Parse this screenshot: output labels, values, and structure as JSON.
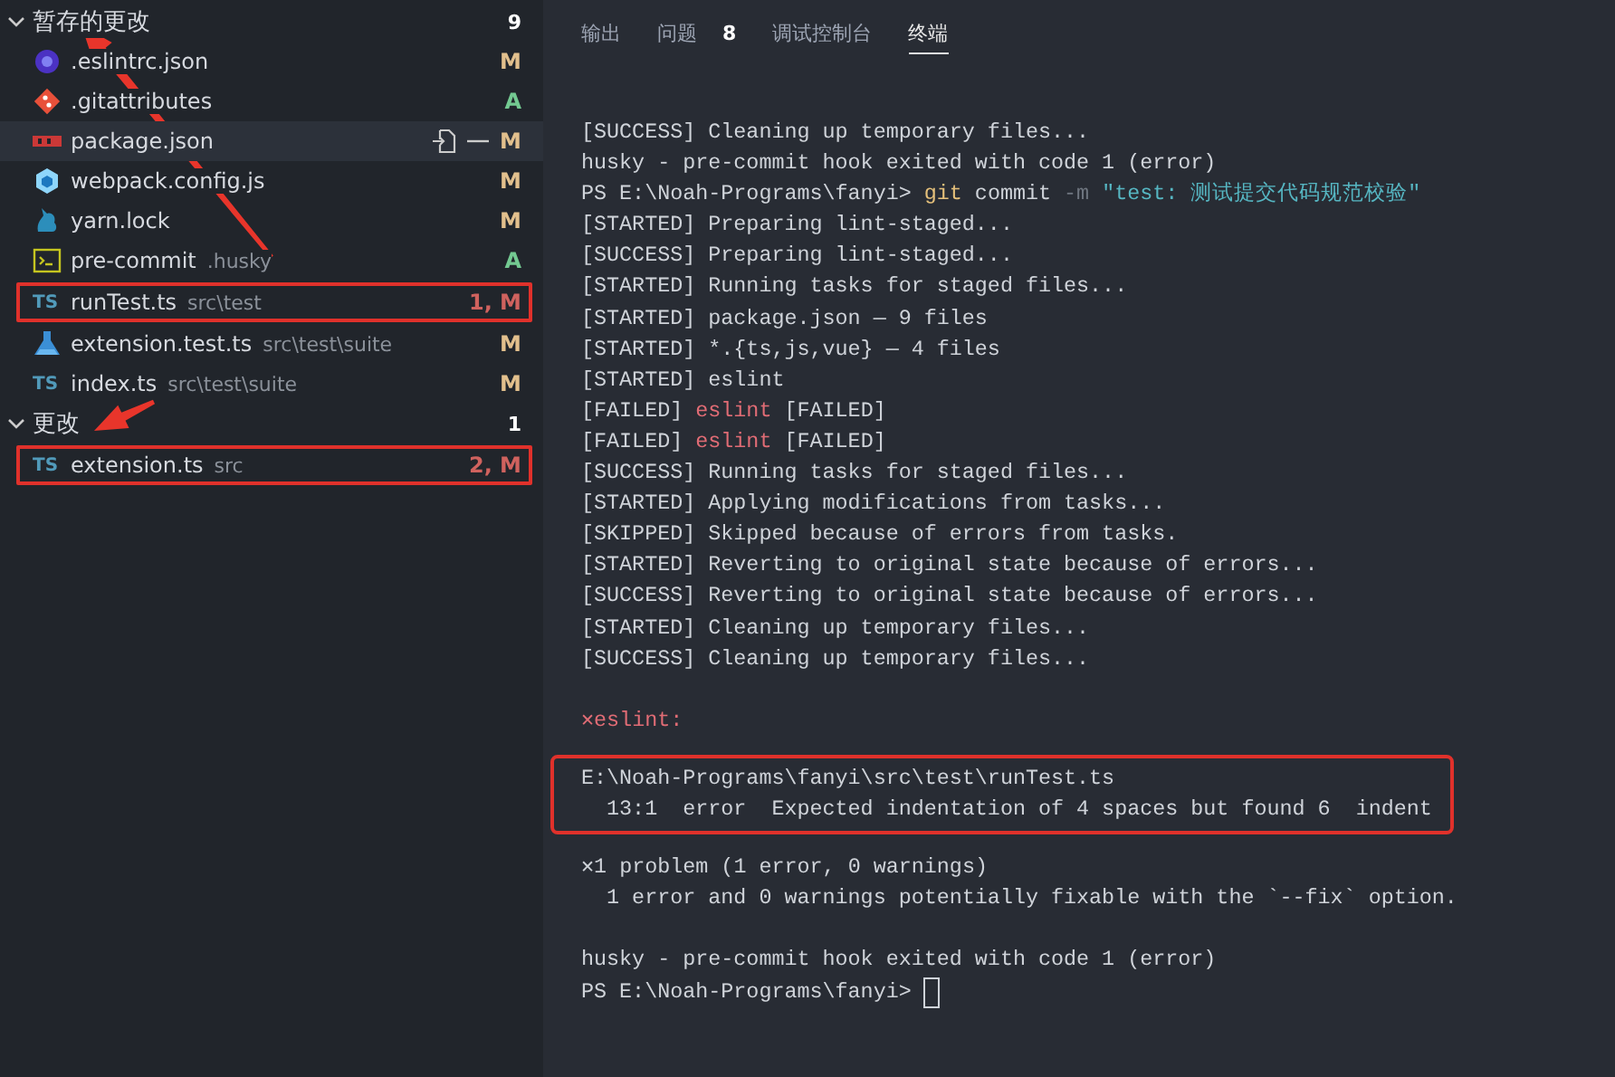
{
  "sidebar": {
    "groups": [
      {
        "title": "暂存的更改",
        "count": "9",
        "expanded": true,
        "items": [
          {
            "kind": "eslint",
            "name": ".eslintrc.json",
            "status": "M",
            "color": "#e2c08d",
            "selected": false,
            "highlighted": false
          },
          {
            "kind": "git",
            "name": ".gitattributes",
            "status": "A",
            "color": "#73c991",
            "selected": false,
            "highlighted": false
          },
          {
            "kind": "npm",
            "name": "package.json",
            "status": "M",
            "color": "#e2c08d",
            "selected": true,
            "highlighted": false
          },
          {
            "kind": "webpack",
            "name": "webpack.config.js",
            "status": "M",
            "color": "#e2c08d",
            "selected": false,
            "highlighted": false
          },
          {
            "kind": "yarn",
            "name": "yarn.lock",
            "status": "M",
            "color": "#e2c08d",
            "selected": false,
            "highlighted": false
          },
          {
            "kind": "shell",
            "name": "pre-commit",
            "description": ".husky",
            "status": "A",
            "color": "#73c991",
            "selected": false,
            "highlighted": false
          },
          {
            "kind": "ts",
            "icon_label": "TS",
            "name": "runTest.ts",
            "description": "src\\test",
            "status": "1, M",
            "color": "#d0625e",
            "selected": false,
            "highlighted": true
          },
          {
            "kind": "test",
            "name": "extension.test.ts",
            "description": "src\\test\\suite",
            "status": "M",
            "color": "#e2c08d",
            "selected": false,
            "highlighted": false
          },
          {
            "kind": "ts",
            "icon_label": "TS",
            "name": "index.ts",
            "description": "src\\test\\suite",
            "status": "M",
            "color": "#e2c08d",
            "selected": false,
            "highlighted": false
          }
        ]
      },
      {
        "title": "更改",
        "count": "1",
        "expanded": true,
        "items": [
          {
            "kind": "ts",
            "icon_label": "TS",
            "name": "extension.ts",
            "description": "src",
            "status": "2, M",
            "color": "#d0625e",
            "selected": false,
            "highlighted": true
          }
        ]
      }
    ]
  },
  "panel": {
    "tabs": [
      {
        "label": "输出",
        "selected": false
      },
      {
        "label": "问题",
        "badge": "8",
        "selected": false
      },
      {
        "label": "调试控制台",
        "selected": false
      },
      {
        "label": "终端",
        "selected": true
      }
    ],
    "terminal": {
      "sections": [
        {
          "lines": [
            [
              {
                "text": "[SUCCESS] Cleaning up temporary files...",
                "kind": "plain"
              }
            ],
            [
              {
                "text": "husky - pre-commit hook exited with code 1 (error)",
                "kind": "plain"
              }
            ],
            [
              {
                "text": "PS E:\\Noah-Programs\\fanyi> ",
                "kind": "plain"
              },
              {
                "text": "git",
                "kind": "command"
              },
              {
                "text": " commit ",
                "kind": "plain"
              },
              {
                "text": "-m",
                "kind": "flag"
              },
              {
                "text": " \"test: 测试提交代码规范校验\"",
                "kind": "string"
              }
            ],
            [
              {
                "text": "[STARTED] Preparing lint-staged...",
                "kind": "plain"
              }
            ],
            [
              {
                "text": "[SUCCESS] Preparing lint-staged...",
                "kind": "plain"
              }
            ],
            [
              {
                "text": "[STARTED] Running tasks for staged files...",
                "kind": "plain"
              }
            ],
            [
              {
                "text": "[STARTED] package.json — 9 files",
                "kind": "plain"
              }
            ],
            [
              {
                "text": "[STARTED] *.{ts,js,vue} — 4 files",
                "kind": "plain"
              }
            ],
            [
              {
                "text": "[STARTED] eslint",
                "kind": "plain"
              }
            ],
            [
              {
                "text": "[FAILED] ",
                "kind": "plain"
              },
              {
                "text": "eslint",
                "kind": "error"
              },
              {
                "text": " [FAILED]",
                "kind": "plain"
              }
            ],
            [
              {
                "text": "[FAILED] ",
                "kind": "plain"
              },
              {
                "text": "eslint",
                "kind": "error"
              },
              {
                "text": " [FAILED]",
                "kind": "plain"
              }
            ],
            [
              {
                "text": "[SUCCESS] Running tasks for staged files...",
                "kind": "plain"
              }
            ],
            [
              {
                "text": "[STARTED] Applying modifications from tasks...",
                "kind": "plain"
              }
            ],
            [
              {
                "text": "[SKIPPED] Skipped because of errors from tasks.",
                "kind": "plain"
              }
            ],
            [
              {
                "text": "[STARTED] Reverting to original state because of errors...",
                "kind": "plain"
              }
            ],
            [
              {
                "text": "[SUCCESS] Reverting to original state because of errors...",
                "kind": "plain"
              }
            ],
            [
              {
                "text": "[STARTED] Cleaning up temporary files...",
                "kind": "plain"
              }
            ],
            [
              {
                "text": "[SUCCESS] Cleaning up temporary files...",
                "kind": "plain"
              }
            ]
          ]
        },
        {
          "lines": [
            [
              {
                "text": "✕",
                "kind": "error_mark"
              },
              {
                "text": "eslint:",
                "kind": "error"
              }
            ]
          ]
        },
        {
          "boxed": true,
          "lines": [
            [
              {
                "text": "E:\\Noah-Programs\\fanyi\\src\\test\\runTest.ts",
                "kind": "plain"
              }
            ],
            [
              {
                "text": "  13:1  error  Expected indentation of 4 spaces but found 6  indent",
                "kind": "plain"
              }
            ]
          ]
        },
        {
          "lines": [
            [
              {
                "text": "✕",
                "kind": "mark"
              },
              {
                "text": "1 problem (1 error, 0 warnings)",
                "kind": "plain"
              }
            ],
            [
              {
                "text": "  1 error and 0 warnings potentially fixable with the `--fix` option.",
                "kind": "plain"
              }
            ]
          ]
        },
        {
          "cursor": true,
          "lines": [
            [
              {
                "text": "husky - pre-commit hook exited with code 1 (error)",
                "kind": "plain"
              }
            ],
            [
              {
                "text": "PS E:\\Noah-Programs\\fanyi> ",
                "kind": "plain"
              }
            ]
          ]
        }
      ]
    }
  },
  "annotations": [
    {
      "kind": "arrow"
    },
    {
      "kind": "arrow"
    }
  ]
}
